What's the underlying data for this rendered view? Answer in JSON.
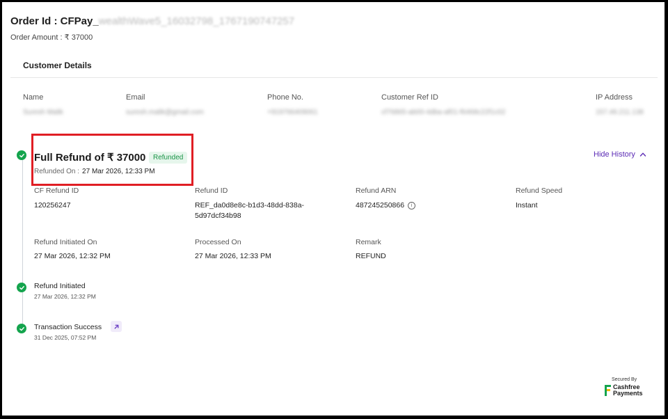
{
  "header": {
    "order_id_prefix": "Order Id : CFPay_",
    "order_id_rest": "wealthWave5_16032798_1767190747257",
    "order_amount": "Order Amount : ₹ 37000"
  },
  "customer": {
    "title": "Customer Details",
    "columns": [
      "Name",
      "Email",
      "Phone No.",
      "Customer Ref ID",
      "IP Address"
    ],
    "values": [
      "Suresh Malik",
      "suresh.malik@gmail.com",
      "+919766409061",
      "cf76865-ab00-4dba-af01-f6468c22f1c02",
      "157.49.211.138"
    ]
  },
  "refund": {
    "title": "Full Refund of ₹ 37000",
    "badge": "Refunded",
    "refunded_on_label": "Refunded On :",
    "refunded_on_value": "27 Mar 2026, 12:33 PM",
    "hide_history": "Hide History",
    "details_row1": [
      {
        "label": "CF Refund ID",
        "value": "120256247"
      },
      {
        "label": "Refund ID",
        "value": "REF_da0d8e8c-b1d3-48dd-838a-",
        "value2": "5d97dcf34b98"
      },
      {
        "label": "Refund ARN",
        "value": "487245250866"
      },
      {
        "label": "Refund Speed",
        "value": "Instant"
      }
    ],
    "details_row2": [
      {
        "label": "Refund Initiated On",
        "value": "27 Mar 2026, 12:32 PM"
      },
      {
        "label": "Processed On",
        "value": "27 Mar 2026, 12:33 PM"
      },
      {
        "label": "Remark",
        "value": "REFUND"
      }
    ]
  },
  "events": [
    {
      "title": "Refund Initiated",
      "date": "27 Mar 2026, 12:32 PM"
    },
    {
      "title": "Transaction Success",
      "date": "31 Dec 2025, 07:52 PM"
    }
  ],
  "footer": {
    "secured_by": "Secured By",
    "brand_line1": "Cashfree",
    "brand_line2": "Payments"
  },
  "colors": {
    "accent": "#5b2bb5",
    "success": "#14a44d",
    "highlight": "#e01e24"
  }
}
